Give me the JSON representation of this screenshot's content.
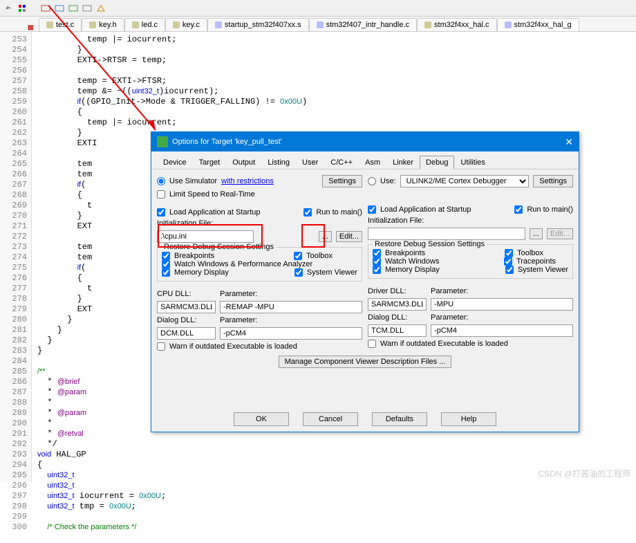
{
  "toolbar_icons": [
    "undo",
    "config",
    "box1",
    "box2",
    "box3",
    "box4",
    "box5"
  ],
  "file_tabs": [
    {
      "name": "test.c",
      "color": "#cc9"
    },
    {
      "name": "key.h",
      "color": "#cc9"
    },
    {
      "name": "led.c",
      "color": "#cc9"
    },
    {
      "name": "key.c",
      "color": "#cc9"
    },
    {
      "name": "startup_stm32f407xx.s",
      "color": "#bbf"
    },
    {
      "name": "stm32f407_intr_handle.c",
      "color": "#bbf"
    },
    {
      "name": "stm32f4xx_hal.c",
      "color": "#cc9"
    },
    {
      "name": "stm32f4xx_hal_g",
      "color": "#bbf",
      "active": true
    }
  ],
  "line_start": 253,
  "code_lines": [
    "          temp |= iocurrent;",
    "        }",
    "        EXTI->RTSR = temp;",
    "",
    "        temp = EXTI->FTSR;",
    "        temp &= ~((uint32_t)iocurrent);",
    "        if((GPIO_Init->Mode & TRIGGER_FALLING) != 0x00U)",
    "        {",
    "          temp |= iocurrent;",
    "        }",
    "        EXTI",
    "",
    "        tem",
    "        tem",
    "        if(",
    "        {",
    "          t",
    "        }",
    "        EXT",
    "",
    "        tem",
    "        tem",
    "        if(",
    "        {",
    "          t",
    "        }",
    "        EXT",
    "      }",
    "    }",
    "  }",
    "}",
    "",
    "/**",
    "  * @brief",
    "  * @param",
    "  *",
    "  * @param                                                                                 devices.",
    "  *",
    "  * @retval",
    "  */",
    "void HAL_GP",
    "{",
    "  uint32_t",
    "  uint32_t",
    "  uint32_t iocurrent = 0x00U;",
    "  uint32_t tmp = 0x00U;",
    "",
    "  /* Check the parameters */"
  ],
  "dialog": {
    "title": "Options for Target 'key_pull_test'",
    "tabs": [
      "Device",
      "Target",
      "Output",
      "Listing",
      "User",
      "C/C++",
      "Asm",
      "Linker",
      "Debug",
      "Utilities"
    ],
    "active_tab": "Debug",
    "left": {
      "use_simulator": "Use Simulator",
      "restrictions": "with restrictions",
      "settings": "Settings",
      "limit_speed": "Limit Speed to Real-Time",
      "load_startup": "Load Application at Startup",
      "run_main": "Run to main()",
      "init_file_label": "Initialization File:",
      "init_file": ".\\cpu.ini",
      "browse": "...",
      "edit": "Edit...",
      "restore_title": "Restore Debug Session Settings",
      "breakpoints": "Breakpoints",
      "toolbox": "Toolbox",
      "watch_perf": "Watch Windows & Performance Analyzer",
      "memory": "Memory Display",
      "sysview": "System Viewer",
      "cpu_dll_label": "CPU DLL:",
      "param_label": "Parameter:",
      "cpu_dll": "SARMCM3.DLL",
      "cpu_param": "-REMAP -MPU",
      "dlg_dll_label": "Dialog DLL:",
      "dlg_dll": "DCM.DLL",
      "dlg_param": "-pCM4",
      "warn": "Warn if outdated Executable is loaded"
    },
    "right": {
      "use": "Use:",
      "debugger": "ULINK2/ME Cortex Debugger",
      "settings": "Settings",
      "load_startup": "Load Application at Startup",
      "run_main": "Run to main()",
      "init_file_label": "Initialization File:",
      "init_file": "",
      "browse": "...",
      "edit": "Edit...",
      "restore_title": "Restore Debug Session Settings",
      "breakpoints": "Breakpoints",
      "toolbox": "Toolbox",
      "watch": "Watch Windows",
      "trace": "Tracepoints",
      "memory": "Memory Display",
      "sysview": "System Viewer",
      "drv_dll_label": "Driver DLL:",
      "param_label": "Parameter:",
      "drv_dll": "SARMCM3.DLL",
      "drv_param": "-MPU",
      "dlg_dll_label": "Dialog DLL:",
      "dlg_dll": "TCM.DLL",
      "dlg_param": "-pCM4",
      "warn": "Warn if outdated Executable is loaded"
    },
    "manage": "Manage Component Viewer Description Files ...",
    "ok": "OK",
    "cancel": "Cancel",
    "defaults": "Defaults",
    "help": "Help"
  },
  "watermark": "CSDN @打酱油的工程师"
}
